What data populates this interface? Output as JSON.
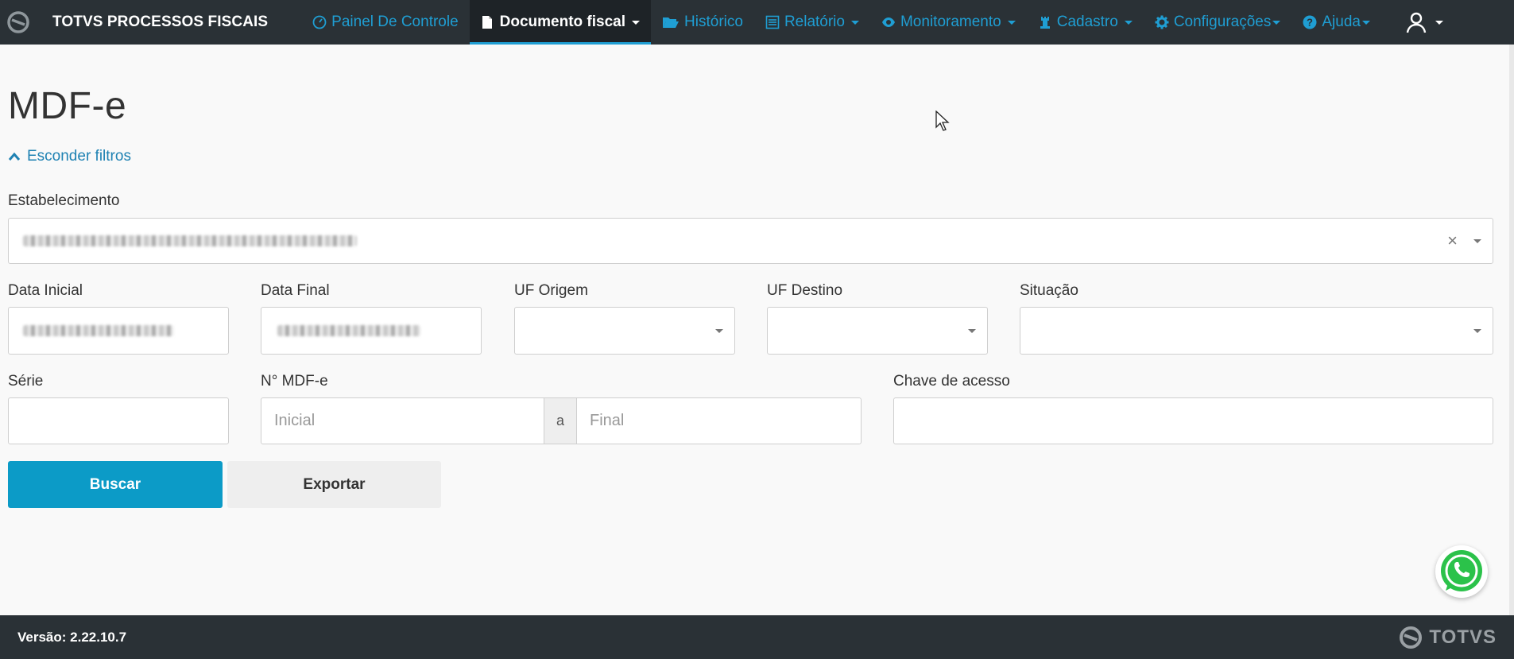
{
  "brand": {
    "name": "TOTVS PROCESSOS FISCAIS",
    "logo_icon": "totvs-logo-icon"
  },
  "nav": {
    "items": [
      {
        "label": "Painel De Controle",
        "icon": "dashboard-icon",
        "dropdown": false,
        "active": false
      },
      {
        "label": "Documento fiscal",
        "icon": "document-icon",
        "dropdown": true,
        "active": true
      },
      {
        "label": "Histórico",
        "icon": "folder-open-icon",
        "dropdown": false,
        "active": false
      },
      {
        "label": "Relatório",
        "icon": "list-alt-icon",
        "dropdown": true,
        "active": false
      },
      {
        "label": "Monitoramento",
        "icon": "eye-icon",
        "dropdown": true,
        "active": false
      },
      {
        "label": "Cadastro",
        "icon": "tower-icon",
        "dropdown": true,
        "active": false
      },
      {
        "label": "Configurações",
        "icon": "gear-icon",
        "dropdown": true,
        "active": false
      },
      {
        "label": "Ajuda",
        "icon": "question-circle-icon",
        "dropdown": true,
        "active": false
      }
    ],
    "user_icon": "user-icon"
  },
  "page": {
    "title": "MDF-e",
    "toggle_filters": "Esconder filtros"
  },
  "filters": {
    "estabelecimento": {
      "label": "Estabelecimento",
      "value_redacted": true,
      "clear_symbol": "×"
    },
    "data_inicial": {
      "label": "Data Inicial",
      "value_redacted": true
    },
    "data_final": {
      "label": "Data Final",
      "value_redacted": true
    },
    "uf_origem": {
      "label": "UF Origem",
      "value": ""
    },
    "uf_destino": {
      "label": "UF Destino",
      "value": ""
    },
    "situacao": {
      "label": "Situação",
      "value": ""
    },
    "serie": {
      "label": "Série",
      "value": ""
    },
    "numero": {
      "label": "N° MDF-e",
      "initial_placeholder": "Inicial",
      "separator": "a",
      "final_placeholder": "Final"
    },
    "chave": {
      "label": "Chave de acesso",
      "value": ""
    }
  },
  "actions": {
    "search": "Buscar",
    "export": "Exportar"
  },
  "footer": {
    "version": "Versão: 2.22.10.7",
    "logo_text": "TOTVS"
  },
  "colors": {
    "navbar": "#2a3136",
    "accent": "#1f9ed3",
    "primary_button": "#0c9bc7"
  }
}
